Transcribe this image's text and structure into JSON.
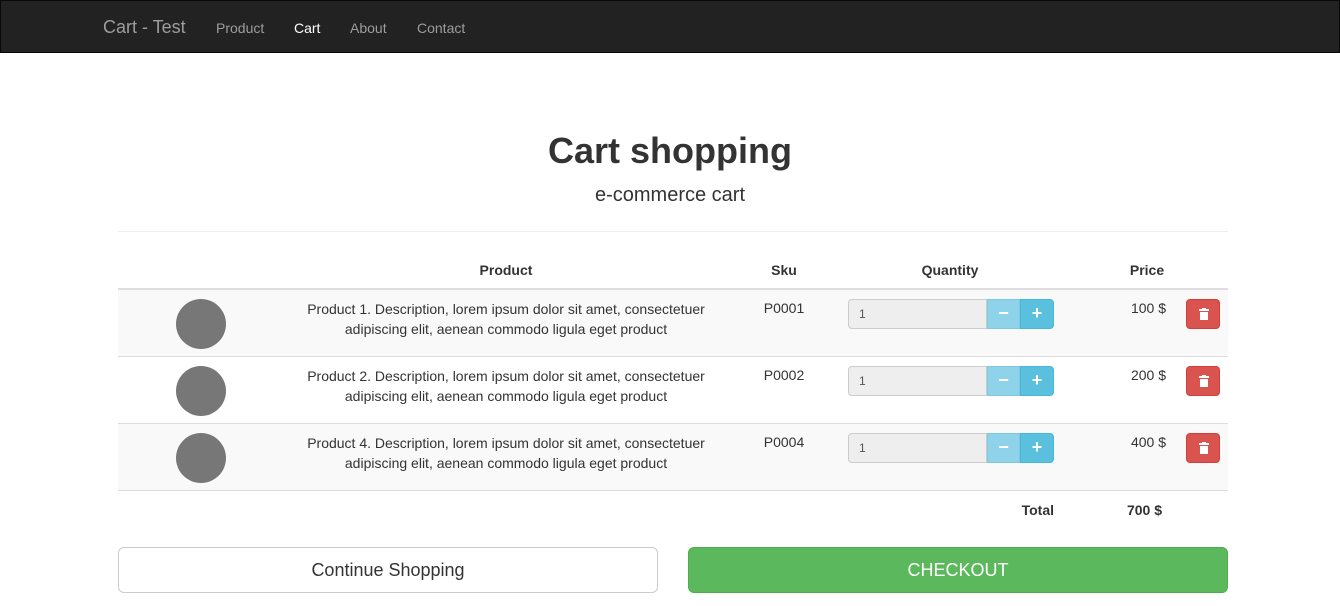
{
  "navbar": {
    "brand": "Cart - Test",
    "links": [
      {
        "label": "Product",
        "active": false
      },
      {
        "label": "Cart",
        "active": true
      },
      {
        "label": "About",
        "active": false
      },
      {
        "label": "Contact",
        "active": false
      }
    ]
  },
  "page": {
    "title": "Cart shopping",
    "subtitle": "e-commerce cart"
  },
  "table": {
    "headers": {
      "product": "Product",
      "sku": "Sku",
      "quantity": "Quantity",
      "price": "Price"
    },
    "rows": [
      {
        "description": "Product 1. Description, lorem ipsum dolor sit amet, consectetuer adipiscing elit, aenean commodo ligula eget product",
        "sku": "P0001",
        "quantity": "1",
        "price": "100 $"
      },
      {
        "description": "Product 2. Description, lorem ipsum dolor sit amet, consectetuer adipiscing elit, aenean commodo ligula eget product",
        "sku": "P0002",
        "quantity": "1",
        "price": "200 $"
      },
      {
        "description": "Product 4. Description, lorem ipsum dolor sit amet, consectetuer adipiscing elit, aenean commodo ligula eget product",
        "sku": "P0004",
        "quantity": "1",
        "price": "400 $"
      }
    ],
    "total_label": "Total",
    "total_value": "700 $"
  },
  "buttons": {
    "minus": "−",
    "plus": "+",
    "continue": "Continue Shopping",
    "checkout": "CHECKOUT"
  },
  "icons": {
    "thumbnail": "product-thumbnail-circle",
    "delete": "trash-icon"
  },
  "colors": {
    "navbar_bg": "#222222",
    "info": "#5bc0de",
    "info_light": "#8ed3ea",
    "danger": "#d9534f",
    "success": "#5cb85c"
  }
}
